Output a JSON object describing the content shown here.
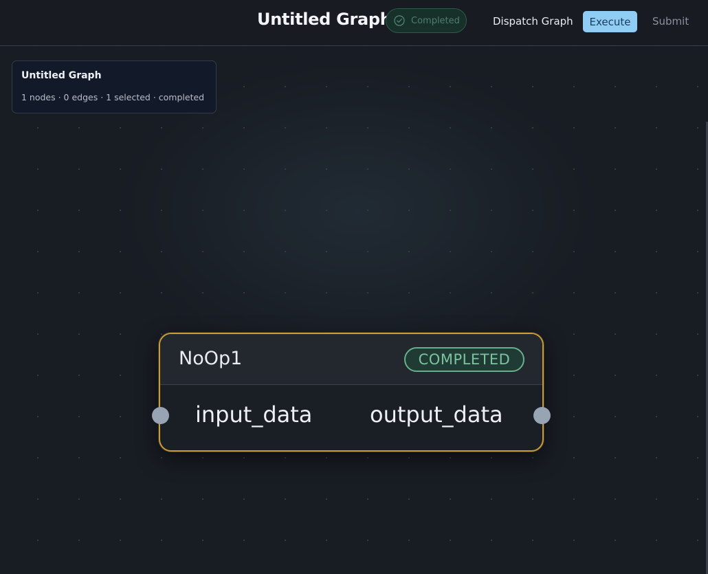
{
  "header": {
    "title": "Untitled Graph",
    "status": "Completed",
    "status_icon": "check-circle-icon",
    "dispatch_label": "Dispatch Graph",
    "execute_label": "Execute",
    "submit_label": "Submit"
  },
  "info_card": {
    "name": "Untitled Graph",
    "meta": "1 nodes · 0 edges · 1 selected · completed"
  },
  "node": {
    "title": "NoOp1",
    "status": "COMPLETED",
    "input_port": "input_data",
    "output_port": "output_data"
  },
  "colors": {
    "accent": "#8fcdf5",
    "selected_border": "#c99a3a",
    "completed": "#67b08d",
    "background": "#181c23"
  }
}
